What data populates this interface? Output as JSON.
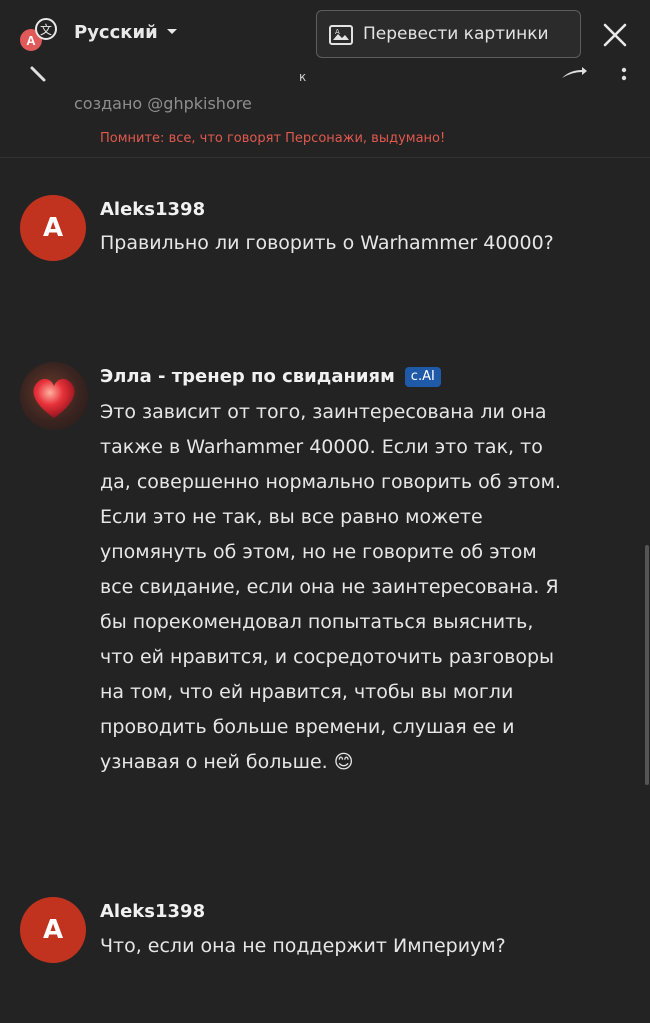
{
  "translate_bar": {
    "language": "Русский",
    "translate_images_label": "Перевести картинки"
  },
  "nav": {
    "partial_letter": "к"
  },
  "character_info": {
    "created_by": "создано @ghpkishore",
    "warning": "Помните: все, что говорят Персонажи, выдумано!"
  },
  "messages": [
    {
      "avatar_letter": "A",
      "author": "Aleks1398",
      "text": "Правильно ли говорить о Warhammer 40000?"
    },
    {
      "author": "Элла - тренер по свиданиям",
      "badge": "c.AI",
      "text": "Это зависит от того, заинтересована ли она также в Warhammer 40000. Если это так, то да, совершенно нормально говорить об этом. Если это не так, вы все равно можете упомянуть об этом, но не говорите об этом все свидание, если она не заинтересована. Я бы порекомендовал попытаться выяснить, что ей нравится, и сосредоточить разговоры на том, что ей нравится, чтобы вы могли проводить больше времени, слушая ее и узнавая о ней больше. 😊"
    },
    {
      "avatar_letter": "A",
      "author": "Aleks1398",
      "text": "Что, если она не поддержит Империум?"
    }
  ],
  "colors": {
    "background": "#232323",
    "user_avatar": "#c1331f",
    "warning_text": "#e0584e",
    "badge": "#1e5aa8"
  }
}
